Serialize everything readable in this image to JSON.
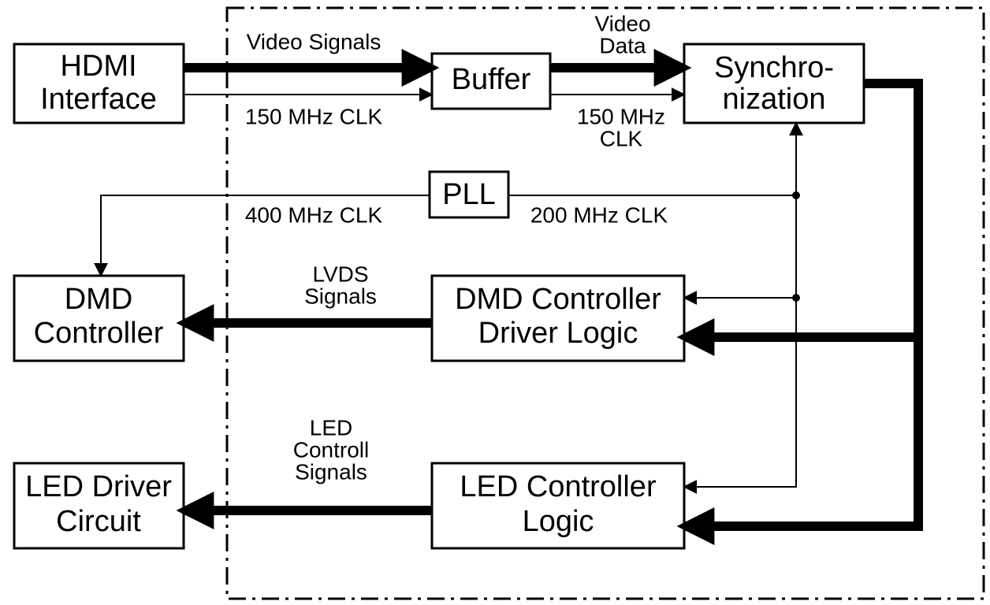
{
  "boxes": {
    "hdmi": {
      "line1": "HDMI",
      "line2": "Interface"
    },
    "buffer": {
      "line1": "Buffer"
    },
    "sync": {
      "line1": "Synchro-",
      "line2": "nization"
    },
    "pll": {
      "line1": "PLL"
    },
    "dmdctl": {
      "line1": "DMD",
      "line2": "Controller"
    },
    "dmddrv": {
      "line1": "DMD Controller",
      "line2": "Driver Logic"
    },
    "leddrv": {
      "line1": "LED Driver",
      "line2": "Circuit"
    },
    "ledctl": {
      "line1": "LED Controller",
      "line2": "Logic"
    }
  },
  "labels": {
    "video_signals": "Video Signals",
    "video_data1": "Video",
    "video_data2": "Data",
    "clk150a": "150 MHz CLK",
    "clk150b1": "150 MHz",
    "clk150b2": "CLK",
    "clk400": "400 MHz CLK",
    "clk200": "200 MHz CLK",
    "lvds1": "LVDS",
    "lvds2": "Signals",
    "led1": "LED",
    "led2": "Controll",
    "led3": "Signals"
  },
  "diagram": {
    "description": "Block diagram of video processing system",
    "blocks": [
      "HDMI Interface",
      "Buffer",
      "Synchronization",
      "PLL",
      "DMD Controller",
      "DMD Controller Driver Logic",
      "LED Driver Circuit",
      "LED Controller Logic"
    ],
    "signals": [
      {
        "from": "HDMI Interface",
        "to": "Buffer",
        "label": "Video Signals",
        "style": "thick"
      },
      {
        "from": "HDMI Interface",
        "to": "Buffer",
        "label": "150 MHz CLK",
        "style": "thin"
      },
      {
        "from": "Buffer",
        "to": "Synchronization",
        "label": "Video Data",
        "style": "thick"
      },
      {
        "from": "Buffer",
        "to": "Synchronization",
        "label": "150 MHz CLK",
        "style": "thin"
      },
      {
        "from": "PLL",
        "to": "DMD Controller",
        "label": "400 MHz CLK",
        "style": "thin"
      },
      {
        "from": "PLL",
        "to": "Synchronization",
        "label": "200 MHz CLK",
        "style": "thin"
      },
      {
        "from": "PLL",
        "to": "DMD Controller Driver Logic",
        "label": "200 MHz CLK",
        "style": "thin"
      },
      {
        "from": "PLL",
        "to": "LED Controller Logic",
        "label": "200 MHz CLK",
        "style": "thin"
      },
      {
        "from": "Synchronization",
        "to": "DMD Controller Driver Logic",
        "style": "thick"
      },
      {
        "from": "Synchronization",
        "to": "LED Controller Logic",
        "style": "thick"
      },
      {
        "from": "DMD Controller Driver Logic",
        "to": "DMD Controller",
        "label": "LVDS Signals",
        "style": "thick"
      },
      {
        "from": "LED Controller Logic",
        "to": "LED Driver Circuit",
        "label": "LED Controll Signals",
        "style": "thick"
      }
    ],
    "boundary": "dash-dot box around Buffer, Synchronization, PLL, DMD Controller Driver Logic, LED Controller Logic"
  }
}
